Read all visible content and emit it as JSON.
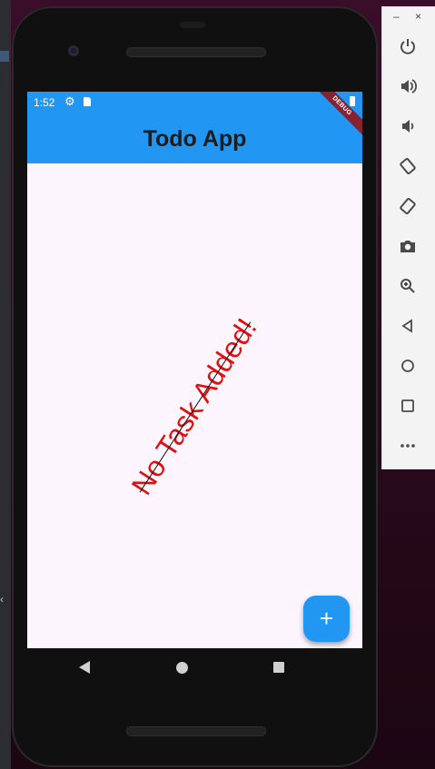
{
  "status_bar": {
    "time": "1:52",
    "icons": [
      "gear-icon",
      "sd-card-icon",
      "battery-icon"
    ],
    "color": "#2196f3"
  },
  "app_bar": {
    "title": "Todo App",
    "color": "#2196f3"
  },
  "debug_banner": {
    "label": "DEBUG",
    "color": "#8a2130"
  },
  "body": {
    "empty_message": "No Task Added!",
    "message_color": "#e01010",
    "background": "#fcf5fd"
  },
  "fab": {
    "icon": "plus-icon",
    "label": "+",
    "color": "#2196f3"
  },
  "navigation": {
    "buttons": [
      "back-icon",
      "home-icon",
      "recents-icon"
    ]
  },
  "emulator_panel": {
    "window_controls": {
      "minimize": "–",
      "close": "×"
    },
    "buttons": [
      "power-icon",
      "volume-up-icon",
      "volume-down-icon",
      "rotate-left-icon",
      "rotate-right-icon",
      "camera-icon",
      "zoom-icon",
      "back-icon",
      "home-icon",
      "overview-icon",
      "more-icon"
    ]
  }
}
